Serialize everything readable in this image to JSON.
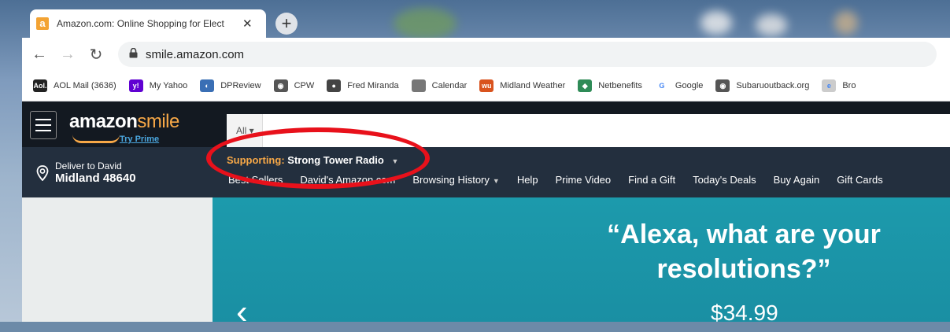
{
  "tab": {
    "title": "Amazon.com: Online Shopping for Elect",
    "favicon": "a"
  },
  "toolbar": {
    "url": "smile.amazon.com"
  },
  "bookmarks": [
    {
      "label": "AOL Mail (3636)",
      "icon": "aol-icon",
      "color": "#222222",
      "glyph": "Aol."
    },
    {
      "label": "My Yahoo",
      "icon": "yahoo-icon",
      "color": "#6001d2",
      "glyph": "y!"
    },
    {
      "label": "DPReview",
      "icon": "dpreview-icon",
      "color": "#3a6fb5",
      "glyph": "◐"
    },
    {
      "label": "CPW",
      "icon": "globe-icon",
      "color": "#555555",
      "glyph": "◉"
    },
    {
      "label": "Fred Miranda",
      "icon": "fredmiranda-icon",
      "color": "#444444",
      "glyph": "●"
    },
    {
      "label": "Calendar",
      "icon": "apple-icon",
      "color": "#777777",
      "glyph": ""
    },
    {
      "label": "Midland Weather",
      "icon": "weather-icon",
      "color": "#d9531e",
      "glyph": "wu"
    },
    {
      "label": "Netbenefits",
      "icon": "netbenefits-icon",
      "color": "#2e8b57",
      "glyph": "◆"
    },
    {
      "label": "Google",
      "icon": "google-icon",
      "color": "#ffffff",
      "glyph": "G"
    },
    {
      "label": "Subaruoutback.org",
      "icon": "globe-icon",
      "color": "#555555",
      "glyph": "◉"
    },
    {
      "label": "Bro",
      "icon": "page-icon",
      "color": "#cccccc",
      "glyph": "e"
    }
  ],
  "amazon": {
    "logo_main": "amazon",
    "logo_accent": "smile",
    "try_prime": "Try Prime",
    "search_category": "All",
    "deliver_line1": "Deliver to David",
    "deliver_line2": "Midland 48640",
    "supporting_label": "Supporting:",
    "supporting_value": "Strong Tower Radio",
    "nav_links": [
      "Best Sellers",
      "David's Amazon.com",
      "Browsing History",
      "Help",
      "Prime Video",
      "Find a Gift",
      "Today's Deals",
      "Buy Again",
      "Gift Cards"
    ]
  },
  "hero": {
    "quote": "“Alexa, what are your resolutions?”",
    "price": "$34.99"
  },
  "colors": {
    "annotation": "#e8111b",
    "amazon_dark": "#131921",
    "amazon_nav": "#232f3e",
    "accent": "#f7a847"
  }
}
